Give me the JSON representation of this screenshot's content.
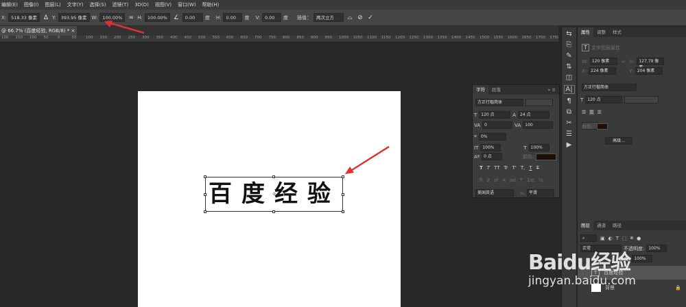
{
  "menu": [
    "编辑(E)",
    "图像(I)",
    "图层(L)",
    "文字(Y)",
    "选择(S)",
    "滤镜(T)",
    "3D(D)",
    "视图(V)",
    "窗口(W)",
    "帮助(H)"
  ],
  "options": {
    "x_label": "X:",
    "x_value": "518.33 像素",
    "y_label": "Y:",
    "y_value": "393.95 像素",
    "w_label": "W:",
    "w_value": "100.00%",
    "h_label": "H:",
    "h_value": "100.00%",
    "angle_value": "0.00",
    "angle_unit": "度",
    "hskew_label": "H:",
    "hskew_value": "0.00",
    "hskew_unit": "度",
    "vskew_label": "V:",
    "vskew_value": "0.00",
    "vskew_unit": "度",
    "interp_label": "插值：",
    "interp_value": "两次立方"
  },
  "doc_tab": "@ 66.7% (百度经验, RGB/8) *",
  "ruler_ticks": [
    "100",
    "150",
    "100",
    "50",
    "0",
    "50",
    "100",
    "150",
    "200",
    "250",
    "300",
    "350",
    "400",
    "450",
    "500",
    "550",
    "600",
    "650",
    "700",
    "750",
    "800",
    "850",
    "900",
    "950",
    "1000",
    "1050",
    "1100",
    "1150",
    "1200",
    "1250",
    "1300",
    "1350",
    "1400",
    "1450",
    "1500",
    "1550",
    "1600",
    "1650",
    "1700",
    "1750"
  ],
  "canvas_text": "百度经验",
  "properties": {
    "tabs": [
      "属性",
      "调整",
      "样式"
    ],
    "title": "文字图层属性",
    "w_label": "W:",
    "w_value": "120 像素",
    "h_label": "H:",
    "h_value": "127.79 像素",
    "x_label": "X:",
    "x_value": "224 像素",
    "y_label": "Y:",
    "y_value": "204 像素",
    "font": "方正行楷简体",
    "size": "120 点",
    "color_label": "颜色:",
    "more_button": "高级..."
  },
  "char_panel": {
    "tabs": [
      "字符",
      "段落"
    ],
    "font": "方正行楷简体",
    "size": "120 点",
    "leading": "24 点",
    "kerning": "0",
    "tracking": "100",
    "scale_v": "100%",
    "scale_h": "100%",
    "baseline": "0 点",
    "color_label": "颜色:",
    "styles": [
      "T",
      "T",
      "TT",
      "Tr",
      "T'",
      "T,",
      "T",
      "T"
    ],
    "opentype": [
      "fi",
      "σ",
      "st",
      "A",
      "ad",
      "T",
      "1st",
      "½"
    ],
    "language": "美国英语",
    "aa_label": "aₐ",
    "aa_value": "平滑"
  },
  "layers": {
    "tabs": [
      "图层",
      "通道",
      "路径"
    ],
    "mode": "正常",
    "opacity_label": "不透明度:",
    "opacity_value": "100%",
    "fill_label": "填充:",
    "fill_value": "100%",
    "items": [
      "百度经验",
      "背景"
    ]
  },
  "watermark": {
    "brand": "Baidu经验",
    "url": "jingyan.baidu.com"
  },
  "colors": {
    "accent_arrow": "#e03030",
    "text_color_swatch": "#1e0f06"
  }
}
